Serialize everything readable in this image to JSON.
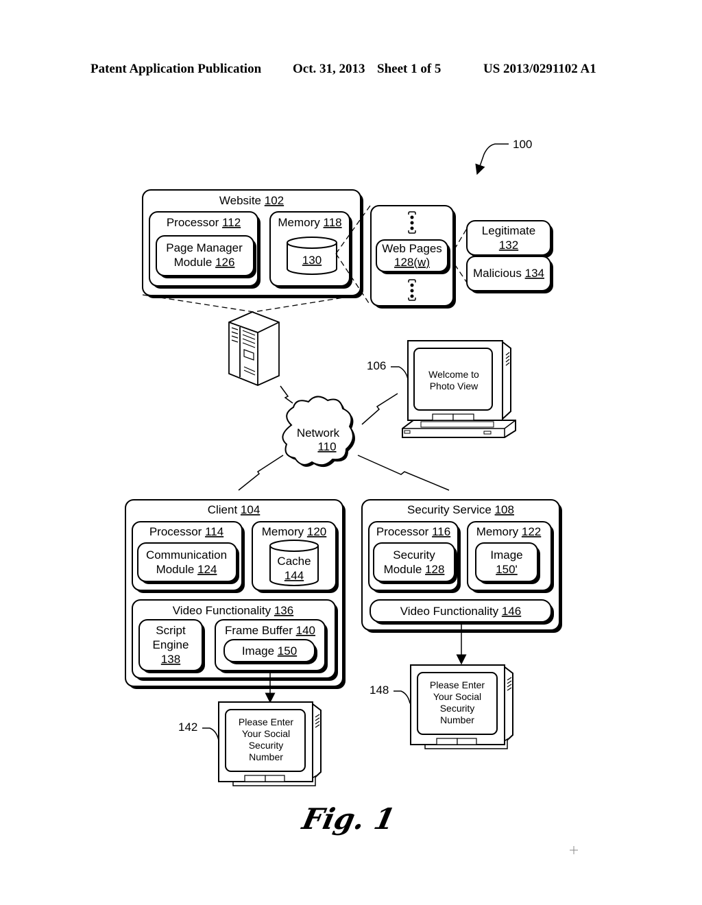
{
  "header": {
    "left": "Patent Application Publication",
    "date": "Oct. 31, 2013",
    "sheet": "Sheet 1 of 5",
    "number": "US 2013/0291102 A1"
  },
  "figure_ref": "100",
  "figure_caption": "Fig. 1",
  "website": {
    "title": "Website",
    "ref": "102",
    "processor": {
      "title": "Processor",
      "ref": "112",
      "module_line1": "Page Manager",
      "module_line2": "Module",
      "module_ref": "126"
    },
    "memory": {
      "title": "Memory",
      "ref": "118",
      "store_ref": "130"
    }
  },
  "web_pages": {
    "title": "Web Pages",
    "ref": "128(w)"
  },
  "legitimate": {
    "title": "Legitimate",
    "ref": "132"
  },
  "malicious": {
    "title": "Malicious",
    "ref": "134"
  },
  "network": {
    "title": "Network",
    "ref": "110"
  },
  "display_106": {
    "ref": "106",
    "line1": "Welcome to",
    "line2": "Photo View"
  },
  "client": {
    "title": "Client",
    "ref": "104",
    "processor": {
      "title": "Processor",
      "ref": "114",
      "module_line1": "Communication",
      "module_line2": "Module",
      "module_ref": "124"
    },
    "memory": {
      "title": "Memory",
      "ref": "120",
      "cache": "Cache",
      "cache_ref": "144"
    },
    "video": {
      "title": "Video Functionality",
      "ref": "136",
      "script_line1": "Script",
      "script_line2": "Engine",
      "script_ref": "138",
      "frame_buffer": "Frame Buffer",
      "frame_buffer_ref": "140",
      "image": "Image",
      "image_ref": "150"
    }
  },
  "security_service": {
    "title": "Security Service",
    "ref": "108",
    "processor": {
      "title": "Processor",
      "ref": "116",
      "module_line1": "Security",
      "module_line2": "Module",
      "module_ref": "128"
    },
    "memory": {
      "title": "Memory",
      "ref": "122",
      "image": "Image",
      "image_ref": "150'"
    },
    "video": {
      "title": "Video Functionality",
      "ref": "146"
    }
  },
  "display_142": {
    "ref": "142",
    "lines": [
      "Please Enter",
      "Your Social",
      "Security",
      "Number"
    ]
  },
  "display_148": {
    "ref": "148",
    "lines": [
      "Please Enter",
      "Your Social",
      "Security",
      "Number"
    ]
  }
}
